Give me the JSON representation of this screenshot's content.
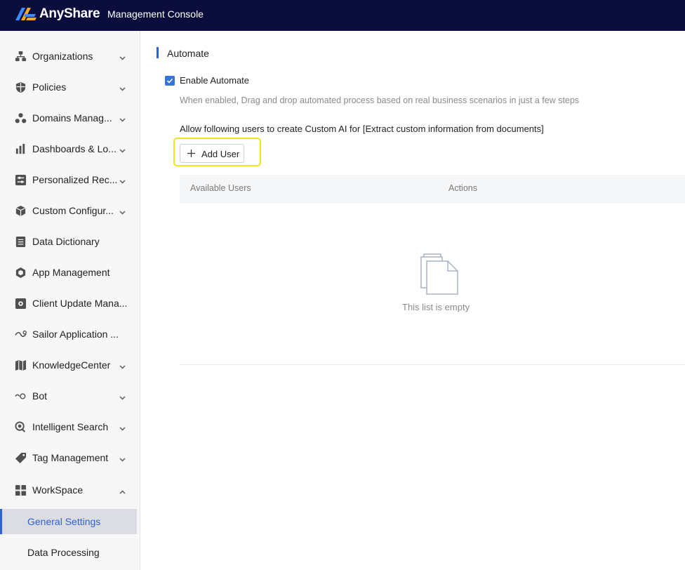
{
  "header": {
    "brand": "AnyShare",
    "console_title": "Management Console"
  },
  "sidebar": {
    "items": [
      {
        "label": "Organizations",
        "icon": "org-chart-icon",
        "expandable": true,
        "expanded": false
      },
      {
        "label": "Policies",
        "icon": "shield-icon",
        "expandable": true,
        "expanded": false
      },
      {
        "label": "Domains Manag...",
        "icon": "domains-icon",
        "expandable": true,
        "expanded": false
      },
      {
        "label": "Dashboards & Lo...",
        "icon": "bar-chart-icon",
        "expandable": true,
        "expanded": false
      },
      {
        "label": "Personalized Rec...",
        "icon": "sliders-icon",
        "expandable": true,
        "expanded": false
      },
      {
        "label": "Custom Configur...",
        "icon": "cube-icon",
        "expandable": true,
        "expanded": false
      },
      {
        "label": "Data Dictionary",
        "icon": "book-icon",
        "expandable": false
      },
      {
        "label": "App Management",
        "icon": "hexagon-icon",
        "expandable": false
      },
      {
        "label": "Client Update Mana...",
        "icon": "client-update-icon",
        "expandable": false
      },
      {
        "label": "Sailor Application ...",
        "icon": "sailor-icon",
        "expandable": false
      },
      {
        "label": "KnowledgeCenter",
        "icon": "map-icon",
        "expandable": true,
        "expanded": false
      },
      {
        "label": "Bot",
        "icon": "bot-icon",
        "expandable": true,
        "expanded": false
      },
      {
        "label": "Intelligent Search",
        "icon": "search-icon",
        "expandable": true,
        "expanded": false
      },
      {
        "label": "Tag Management",
        "icon": "tag-icon",
        "expandable": true,
        "expanded": false
      },
      {
        "label": "WorkSpace",
        "icon": "grid-icon",
        "expandable": true,
        "expanded": true
      }
    ],
    "sub_items": [
      {
        "label": "General Settings",
        "active": true
      },
      {
        "label": "Data Processing",
        "active": false
      }
    ]
  },
  "main": {
    "section_title": "Automate",
    "enable_checkbox": {
      "label": "Enable Automate",
      "checked": true
    },
    "hint": "When enabled, Drag and drop automated process based on real business scenarios in just a few steps",
    "allow_text": "Allow following users to create Custom AI for [Extract custom information from documents]",
    "add_user_label": "Add User",
    "table": {
      "columns": [
        "Available Users",
        "Actions"
      ],
      "empty_text": "This list is empty"
    }
  },
  "colors": {
    "header_bg": "#0b0d3d",
    "accent": "#2a62d9",
    "highlight": "#f2e51b"
  }
}
